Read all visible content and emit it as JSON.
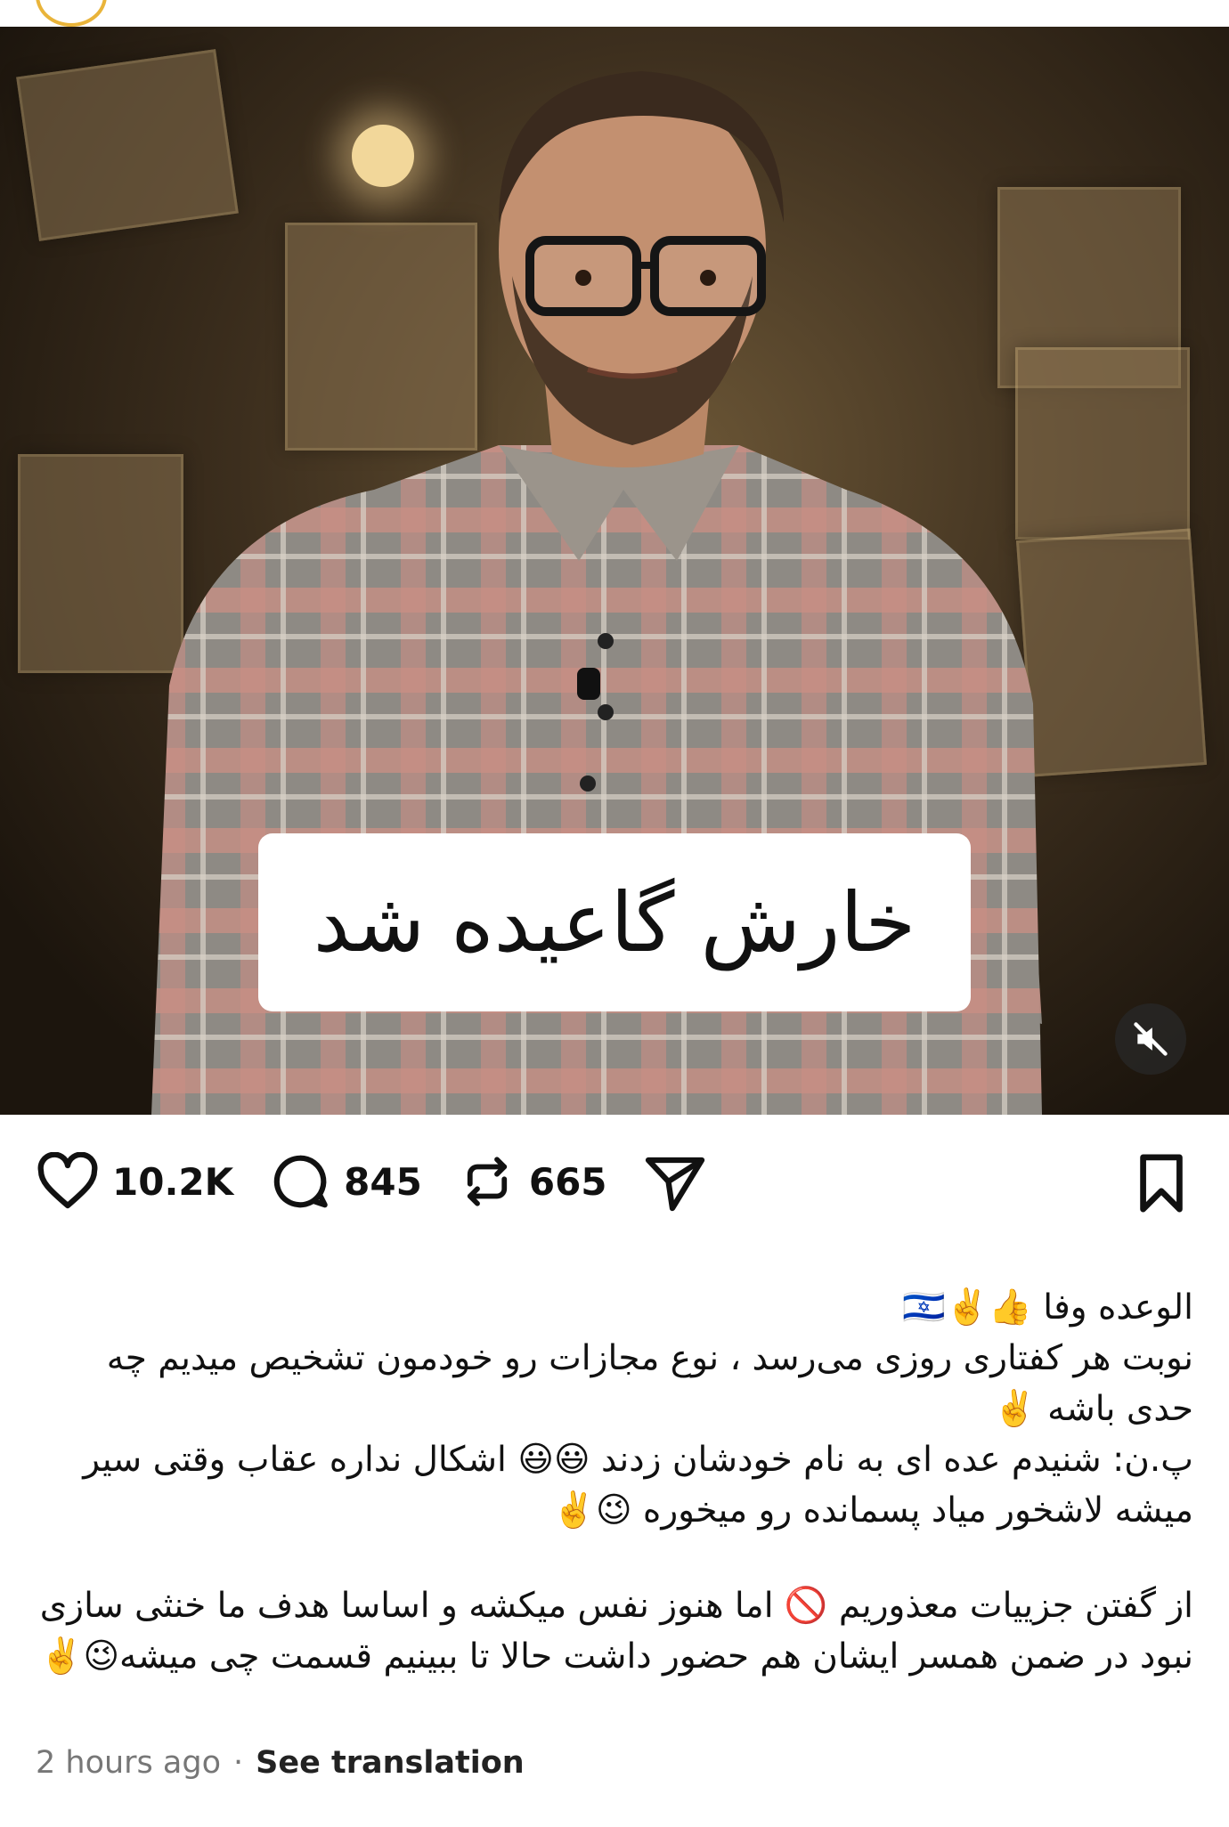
{
  "media": {
    "overlay_text": "خارش گاعیده شد",
    "mute_icon": "speaker-muted-icon"
  },
  "actions": {
    "likes": "10.2K",
    "comments": "845",
    "reposts": "665"
  },
  "caption": {
    "lines": [
      "الوعده وفا 👍✌️🇮🇱",
      "نوبت هر کفتاری روزی می‌رسد ، نوع مجازات رو خودمون تشخیص میدیم چه حدی باشه ✌️",
      "پ.ن: شنیدم عده ای به نام خودشان زدند 😃😃 اشکال نداره عقاب وقتی سیر میشه لاشخور میاد پسمانده رو میخوره 😉✌️",
      "از گفتن جزییات معذوریم 🚫 اما هنوز نفس میکشه و اساسا هدف ما خنثی سازی نبود در ضمن همسر ایشان هم حضور داشت حالا تا ببینیم قسمت چی میشه😉✌️"
    ]
  },
  "meta": {
    "time": "2 hours ago",
    "separator": "·",
    "translate": "See translation"
  }
}
